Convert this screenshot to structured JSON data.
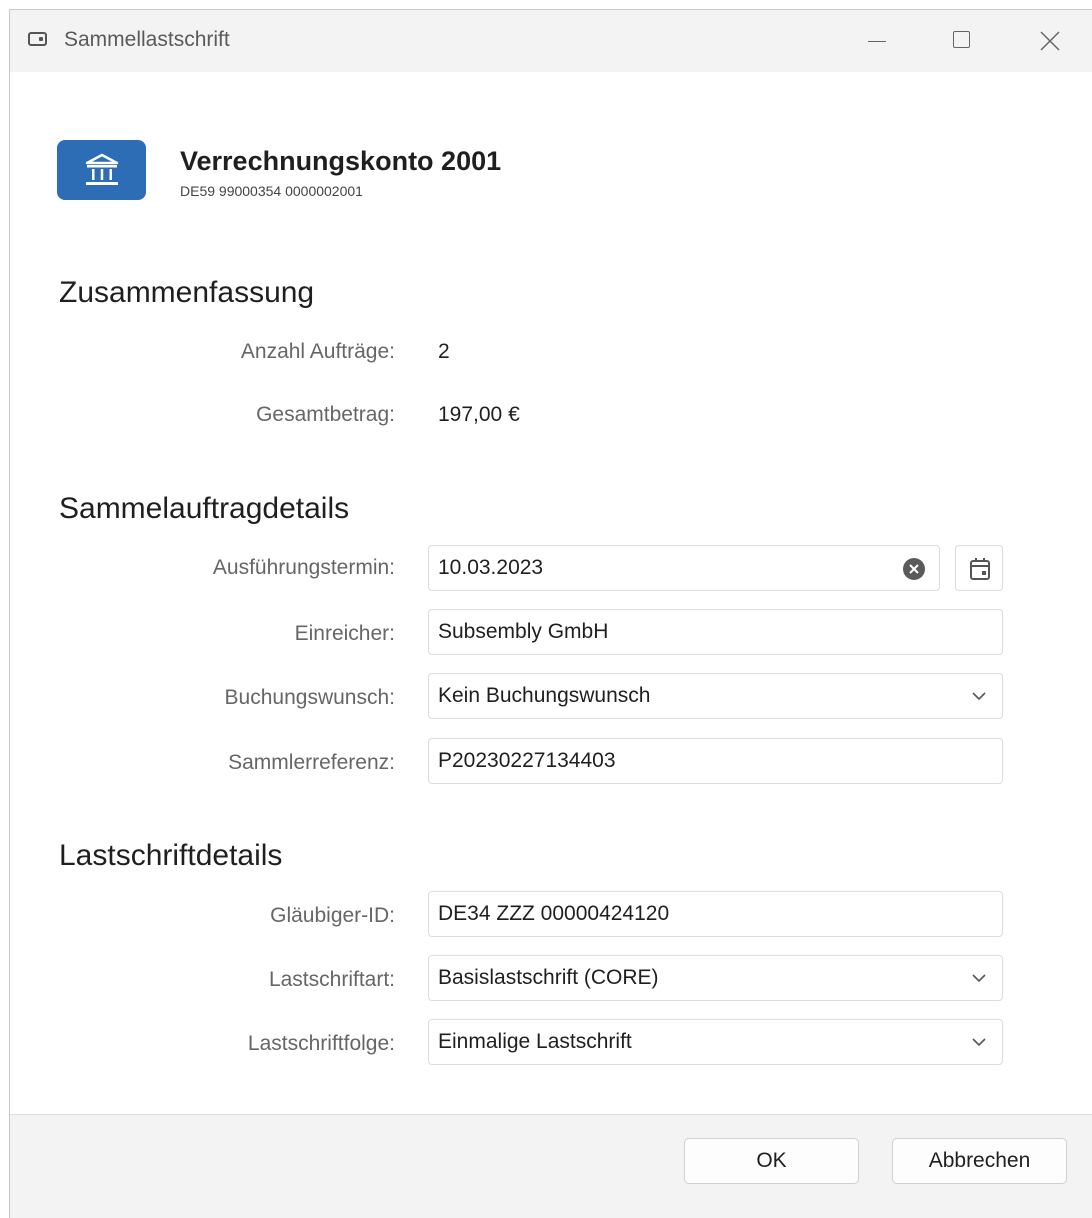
{
  "window": {
    "title": "Sammellastschrift"
  },
  "account": {
    "name": "Verrechnungskonto 2001",
    "iban": "DE59 99000354 0000002001"
  },
  "summary": {
    "heading": "Zusammenfassung",
    "count_label": "Anzahl Aufträge:",
    "count_value": "2",
    "total_label": "Gesamtbetrag:",
    "total_value": "197,00 €"
  },
  "batch": {
    "heading": "Sammelauftragdetails",
    "date_label": "Ausführungstermin:",
    "date_value": "10.03.2023",
    "submitter_label": "Einreicher:",
    "submitter_value": "Subsembly GmbH",
    "booking_label": "Buchungswunsch:",
    "booking_value": "Kein Buchungswunsch",
    "reference_label": "Sammlerreferenz:",
    "reference_value": "P20230227134403"
  },
  "debit": {
    "heading": "Lastschriftdetails",
    "creditor_label": "Gläubiger-ID:",
    "creditor_value": "DE34 ZZZ 00000424120",
    "type_label": "Lastschriftart:",
    "type_value": "Basislastschrift (CORE)",
    "sequence_label": "Lastschriftfolge:",
    "sequence_value": "Einmalige Lastschrift"
  },
  "buttons": {
    "ok": "OK",
    "cancel": "Abbrechen"
  },
  "colors": {
    "accent": "#2d6db5",
    "footer_bg": "#f3f3f3"
  },
  "icons": [
    "app-window-icon",
    "minimize-icon",
    "maximize-icon",
    "close-icon",
    "bank-icon",
    "clear-icon",
    "calendar-icon",
    "chevron-down-icon"
  ]
}
